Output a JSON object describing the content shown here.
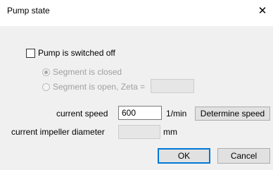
{
  "window": {
    "title": "Pump state",
    "close_glyph": "✕"
  },
  "pump_off": {
    "label": "Pump is switched off",
    "checked": false
  },
  "segment_options": [
    {
      "label": "Segment is closed",
      "selected": true,
      "enabled": false
    },
    {
      "label": "Segment is open, Zeta =",
      "selected": false,
      "enabled": false
    }
  ],
  "zeta_value": "",
  "speed": {
    "label": "current speed",
    "value": "600",
    "unit": "1/min",
    "determine_button": "Determine speed"
  },
  "impeller": {
    "label": "current impeller diameter",
    "value": "",
    "unit": "mm"
  },
  "buttons": {
    "ok": "OK",
    "cancel": "Cancel"
  },
  "icons": {
    "close": "close-icon",
    "radio_checked": "radio-selected",
    "radio_unchecked": "radio-unselected"
  },
  "colors": {
    "dialog_bg": "#f0f0f0",
    "titlebar_bg": "#ffffff",
    "default_button_border": "#0078d7",
    "disabled_text": "#a0a0a0"
  }
}
